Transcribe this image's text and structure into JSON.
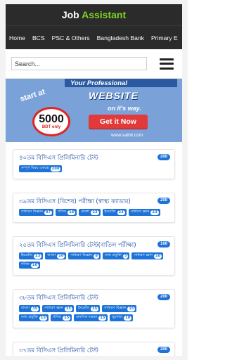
{
  "header": {
    "title_part1": "Job",
    "title_part2": "Assistant",
    "accent_color": "#7ed321"
  },
  "nav": {
    "items": [
      "Home",
      "BCS",
      "PSC & Others",
      "Bangladesh Bank",
      "Primary E"
    ]
  },
  "search": {
    "placeholder": "Search..."
  },
  "menu": {
    "icon": "hamburger-menu-icon"
  },
  "banner": {
    "tagline": "Your Professional",
    "headline": "WEBSITE",
    "subline": "on it's way.",
    "start_text": "start at",
    "price": "5000",
    "price_unit": "BDT only",
    "cta_label": "Get it Now",
    "url": "www.satbit.com",
    "bg_color": "#7aa2d9",
    "cta_color": "#e23a3a"
  },
  "cards": [
    {
      "title": "৪০তম বিসিএস প্রিলিমিনারি টেস্ট",
      "count": "200",
      "tags": [
        {
          "label": "সম্পূর্ণ বিষয় একত্রে",
          "count": "200"
        }
      ]
    },
    {
      "title": "৩৯তম বিসিএস (বিশেষ) পরীক্ষা (স্বাস্থ্য ক্যাডার)",
      "count": "200",
      "tags": [
        {
          "label": "সাধারণ বিজ্ঞান",
          "count": "97"
        },
        {
          "label": "গণিত",
          "count": "16"
        },
        {
          "label": "বাংলা",
          "count": "23"
        },
        {
          "label": "ইংরেজি",
          "count": "23"
        },
        {
          "label": "সাধারণ জ্ঞান",
          "count": "23"
        }
      ]
    },
    {
      "title": "২৫তম বিসিএস প্রিলিমিনারি টেস্ট(বাতিল পরীক্ষা)",
      "count": "100",
      "tags": [
        {
          "label": "ইংরেজি",
          "count": "23"
        },
        {
          "label": "বাংলা",
          "count": "20"
        },
        {
          "label": "সাধারণ বিজ্ঞান",
          "count": "8"
        },
        {
          "label": "তথ্য প্রযুক্তি",
          "count": "5"
        },
        {
          "label": "সাধারণ জ্ঞান",
          "count": "28"
        },
        {
          "label": "গণিত",
          "count": "10"
        }
      ]
    },
    {
      "title": "৩৮তম বিসিএস প্রিলিমিনারি টেস্ট",
      "count": "200",
      "tags": [
        {
          "label": "বাংলা",
          "count": "35"
        },
        {
          "label": "সাধারণ জ্ঞান",
          "count": "35"
        },
        {
          "label": "ইংরেজি",
          "count": "35"
        },
        {
          "label": "সাধারণ বিজ্ঞান",
          "count": "15"
        },
        {
          "label": "তথ্য প্রযুক্তি",
          "count": "15"
        },
        {
          "label": "গণিত",
          "count": "15"
        },
        {
          "label": "মানসিক দক্ষতা",
          "count": "15"
        },
        {
          "label": "ভূগোল",
          "count": "10"
        }
      ]
    },
    {
      "title": "৩৭তম বিসিএস প্রিলিমিনারি টেস্ট",
      "count": "200",
      "tags": []
    }
  ]
}
